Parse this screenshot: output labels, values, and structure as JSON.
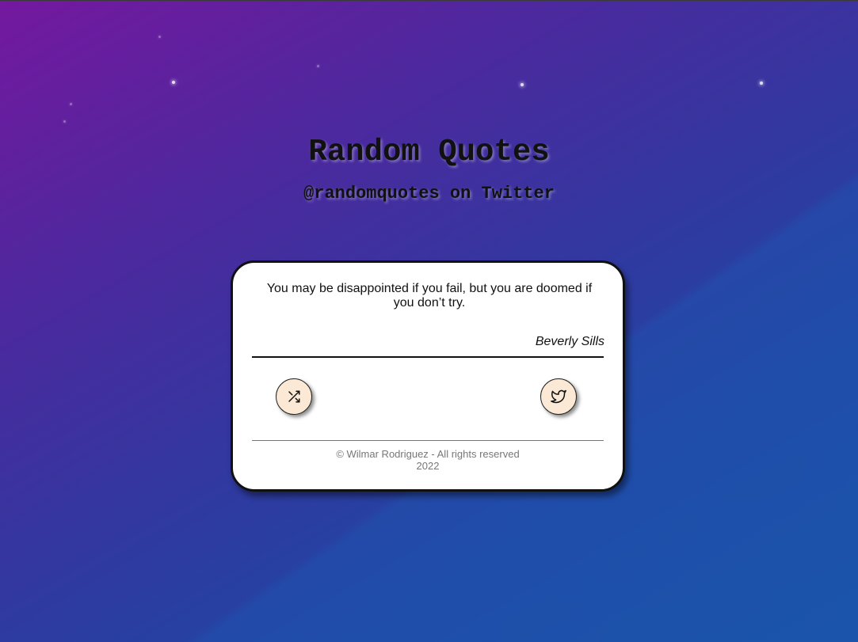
{
  "header": {
    "title": "Random Quotes",
    "subtitle": "@randomquotes on Twitter"
  },
  "quote": {
    "text": "You may be disappointed if you fail, but you are doomed if you don’t try.",
    "author": "Beverly Sills"
  },
  "actions": {
    "new_quote_icon": "shuffle-icon",
    "tweet_icon": "twitter-icon"
  },
  "footer": {
    "line1": "© Wilmar Rodriguez - All rights reserved",
    "line2": "2022"
  },
  "colors": {
    "background_start": "#74189f",
    "background_end": "#1852a6",
    "button_fill": "#fbe9d6",
    "card": "#ffffff",
    "footer_text": "#777777"
  }
}
